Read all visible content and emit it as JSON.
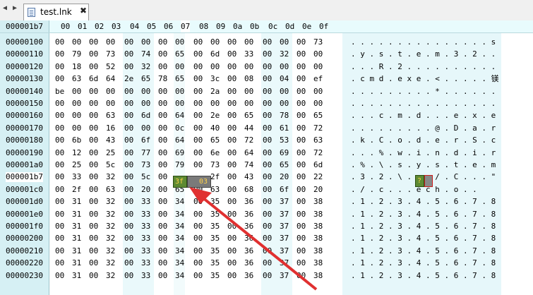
{
  "tabbar": {
    "nav_buttons": "◀ ▶",
    "tab_title": "test.lnk",
    "close": "✖"
  },
  "header": {
    "address": "000001b7",
    "columns": [
      "00",
      "01",
      "02",
      "03",
      "04",
      "05",
      "06",
      "07",
      "08",
      "09",
      "0a",
      "0b",
      "0c",
      "0d",
      "0e",
      "0f"
    ],
    "selected_column_index": 7
  },
  "selection": {
    "address": "000001b7",
    "hex_bytes": [
      "3f",
      "03"
    ],
    "ascii_chars": [
      "?",
      ""
    ],
    "colors": {
      "primary": "#5d8a32",
      "secondary": "#7a7a7a",
      "text": "#ffd24a",
      "ascii_border": "#cc1c1c"
    }
  },
  "annotation": {
    "arrow_color": "#e03030"
  },
  "rows": [
    {
      "addr": "00000100",
      "hex": [
        "00",
        "00",
        "00",
        "00",
        "00",
        "00",
        "00",
        "00",
        "00",
        "00",
        "00",
        "00",
        "00",
        "00",
        "00",
        "73"
      ],
      "ascii": ". . . . . . . . . . . . . . . s"
    },
    {
      "addr": "00000110",
      "hex": [
        "00",
        "79",
        "00",
        "73",
        "00",
        "74",
        "00",
        "65",
        "00",
        "6d",
        "00",
        "33",
        "00",
        "32",
        "00",
        "00"
      ],
      "ascii": ". y . s . t . e . m . 3 . 2 . ."
    },
    {
      "addr": "00000120",
      "hex": [
        "00",
        "18",
        "00",
        "52",
        "00",
        "32",
        "00",
        "00",
        "00",
        "00",
        "00",
        "00",
        "00",
        "00",
        "00",
        "00"
      ],
      "ascii": ". . . R . 2 . . . . . . . . . ."
    },
    {
      "addr": "00000130",
      "hex": [
        "00",
        "63",
        "6d",
        "64",
        "2e",
        "65",
        "78",
        "65",
        "00",
        "3c",
        "00",
        "08",
        "00",
        "04",
        "00",
        "ef"
      ],
      "ascii": ". c m d . e x e . < . . . . . 镁"
    },
    {
      "addr": "00000140",
      "hex": [
        "be",
        "00",
        "00",
        "00",
        "00",
        "00",
        "00",
        "00",
        "00",
        "2a",
        "00",
        "00",
        "00",
        "00",
        "00",
        "00"
      ],
      "ascii": ". . . . . . . . . * . . . . . ."
    },
    {
      "addr": "00000150",
      "hex": [
        "00",
        "00",
        "00",
        "00",
        "00",
        "00",
        "00",
        "00",
        "00",
        "00",
        "00",
        "00",
        "00",
        "00",
        "00",
        "00"
      ],
      "ascii": ". . . . . . . . . . . . . . . ."
    },
    {
      "addr": "00000160",
      "hex": [
        "00",
        "00",
        "00",
        "63",
        "00",
        "6d",
        "00",
        "64",
        "00",
        "2e",
        "00",
        "65",
        "00",
        "78",
        "00",
        "65"
      ],
      "ascii": ". . . c . m . d . . . e . x . e"
    },
    {
      "addr": "00000170",
      "hex": [
        "00",
        "00",
        "00",
        "16",
        "00",
        "00",
        "00",
        "0c",
        "00",
        "40",
        "00",
        "44",
        "00",
        "61",
        "00",
        "72"
      ],
      "ascii": ". . . . . . . . . @ . D . a . r"
    },
    {
      "addr": "00000180",
      "hex": [
        "00",
        "6b",
        "00",
        "43",
        "00",
        "6f",
        "00",
        "64",
        "00",
        "65",
        "00",
        "72",
        "00",
        "53",
        "00",
        "63"
      ],
      "ascii": ". k . C . o . d . e . r . S . c"
    },
    {
      "addr": "00000190",
      "hex": [
        "00",
        "12",
        "00",
        "25",
        "00",
        "77",
        "00",
        "69",
        "00",
        "6e",
        "00",
        "64",
        "00",
        "69",
        "00",
        "72"
      ],
      "ascii": ". . . % . w . i . n . d . i . r"
    },
    {
      "addr": "000001a0",
      "hex": [
        "00",
        "25",
        "00",
        "5c",
        "00",
        "73",
        "00",
        "79",
        "00",
        "73",
        "00",
        "74",
        "00",
        "65",
        "00",
        "6d"
      ],
      "ascii": ". % . \\ . s . y . s . t . e . m"
    },
    {
      "addr": "000001b7",
      "hex": [
        "00",
        "33",
        "00",
        "32",
        "00",
        "5c",
        "00",
        "3f",
        "03",
        "2f",
        "00",
        "43",
        "00",
        "20",
        "00",
        "22"
      ],
      "ascii": ". 3 . 2 . \\ .     / . C . . . \""
    },
    {
      "addr": "000001c0",
      "hex": [
        "00",
        "2f",
        "00",
        "63",
        "00",
        "20",
        "00",
        "65",
        "00",
        "63",
        "00",
        "68",
        "00",
        "6f",
        "00",
        "20"
      ],
      "ascii": ". / . c . . . e c h . o . ."
    },
    {
      "addr": "000001d0",
      "hex": [
        "00",
        "31",
        "00",
        "32",
        "00",
        "33",
        "00",
        "34",
        "00",
        "35",
        "00",
        "36",
        "00",
        "37",
        "00",
        "38"
      ],
      "ascii": ". 1 . 2 . 3 . 4 . 5 . 6 . 7 . 8"
    },
    {
      "addr": "000001e0",
      "hex": [
        "00",
        "31",
        "00",
        "32",
        "00",
        "33",
        "00",
        "34",
        "00",
        "35",
        "00",
        "36",
        "00",
        "37",
        "00",
        "38"
      ],
      "ascii": ". 1 . 2 . 3 . 4 . 5 . 6 . 7 . 8"
    },
    {
      "addr": "000001f0",
      "hex": [
        "00",
        "31",
        "00",
        "32",
        "00",
        "33",
        "00",
        "34",
        "00",
        "35",
        "00",
        "36",
        "00",
        "37",
        "00",
        "38"
      ],
      "ascii": ". 1 . 2 . 3 . 4 . 5 . 6 . 7 . 8"
    },
    {
      "addr": "00000200",
      "hex": [
        "00",
        "31",
        "00",
        "32",
        "00",
        "33",
        "00",
        "34",
        "00",
        "35",
        "00",
        "36",
        "00",
        "37",
        "00",
        "38"
      ],
      "ascii": ". 1 . 2 . 3 . 4 . 5 . 6 . 7 . 8"
    },
    {
      "addr": "00000210",
      "hex": [
        "00",
        "31",
        "00",
        "32",
        "00",
        "33",
        "00",
        "34",
        "00",
        "35",
        "00",
        "36",
        "00",
        "37",
        "00",
        "38"
      ],
      "ascii": ". 1 . 2 . 3 . 4 . 5 . 6 . 7 . 8"
    },
    {
      "addr": "00000220",
      "hex": [
        "00",
        "31",
        "00",
        "32",
        "00",
        "33",
        "00",
        "34",
        "00",
        "35",
        "00",
        "36",
        "00",
        "37",
        "00",
        "38"
      ],
      "ascii": ". 1 . 2 . 3 . 4 . 5 . 6 . 7 . 8"
    },
    {
      "addr": "00000230",
      "hex": [
        "00",
        "31",
        "00",
        "32",
        "00",
        "33",
        "00",
        "34",
        "00",
        "35",
        "00",
        "36",
        "00",
        "37",
        "00",
        "38"
      ],
      "ascii": ". 1 . 2 . 3 . 4 . 5 . 6 . 7 . 8"
    }
  ]
}
